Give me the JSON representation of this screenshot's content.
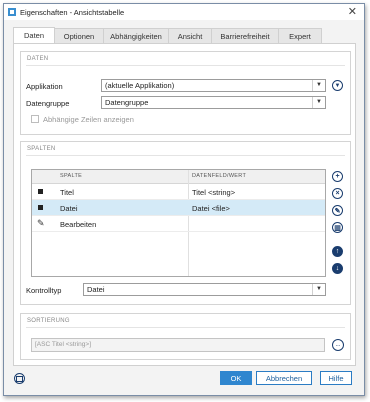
{
  "window": {
    "title": "Eigenschaften - Ansichtstabelle",
    "close_glyph": "✕"
  },
  "tabs": [
    {
      "label": "Daten",
      "active": true
    },
    {
      "label": "Optionen"
    },
    {
      "label": "Abhängigkeiten"
    },
    {
      "label": "Ansicht"
    },
    {
      "label": "Barrierefreiheit"
    },
    {
      "label": "Expert"
    }
  ],
  "daten": {
    "section_title": "DATEN",
    "applikation_label": "Applikation",
    "applikation_value": "(aktuelle Applikation)",
    "datengruppe_label": "Datengruppe",
    "datengruppe_value": "Datengruppe",
    "checkbox_label": "Abhängige Zeilen anzeigen"
  },
  "spalten": {
    "section_title": "SPALTEN",
    "col_headers": [
      "SPALTE",
      "DATENFELD/WERT"
    ],
    "rows": [
      {
        "icon": "square-icon",
        "spalte": "Titel",
        "wert": "Titel <string>",
        "selected": false
      },
      {
        "icon": "square-icon",
        "spalte": "Datei",
        "wert": "Datei <file>",
        "selected": true
      },
      {
        "icon": "pencil-icon",
        "spalte": "Bearbeiten",
        "wert": "",
        "selected": false
      }
    ],
    "kontrolltyp_label": "Kontrolltyp",
    "kontrolltyp_value": "Datei"
  },
  "sortierung": {
    "section_title": "SORTIERUNG",
    "value": "[ASC Titel <string>]",
    "button_label": "..."
  },
  "footer": {
    "ok": "OK",
    "abbrechen": "Abbrechen",
    "hilfe": "Hilfe"
  },
  "colors": {
    "accent": "#2f86cf",
    "selected_row": "#d4eaf7",
    "icon_dark": "#1a3d6e"
  }
}
